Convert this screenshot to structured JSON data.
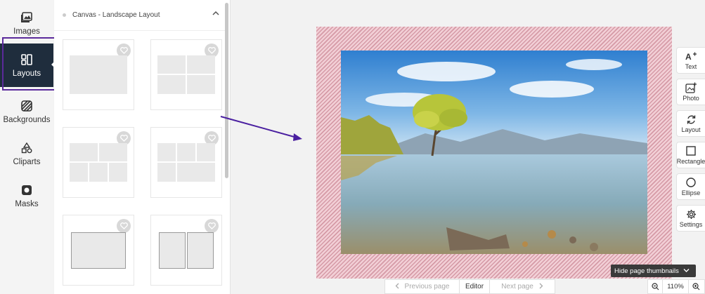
{
  "nav": {
    "items": [
      {
        "label": "Images",
        "icon": "images-icon"
      },
      {
        "label": "Layouts",
        "icon": "layouts-icon",
        "active": true
      },
      {
        "label": "Backgrounds",
        "icon": "backgrounds-icon"
      },
      {
        "label": "Cliparts",
        "icon": "cliparts-icon"
      },
      {
        "label": "Masks",
        "icon": "masks-icon"
      }
    ]
  },
  "panel": {
    "section_title": "Canvas - Landscape Layout"
  },
  "toolbar": {
    "items": [
      {
        "label": "Text",
        "icon": "text-add-icon"
      },
      {
        "label": "Photo",
        "icon": "photo-add-icon"
      },
      {
        "label": "Layout",
        "icon": "layout-refresh-icon"
      },
      {
        "label": "Rectangle",
        "icon": "rectangle-icon"
      },
      {
        "label": "Ellipse",
        "icon": "ellipse-icon"
      },
      {
        "label": "Settings",
        "icon": "gear-icon"
      }
    ]
  },
  "bottom": {
    "previous_page": "Previous page",
    "editor": "Editor",
    "next_page": "Next page",
    "hide_thumbnails": "Hide page thumbnails",
    "zoom_level": "110%"
  },
  "colors": {
    "nav_active": "#1f2d3d",
    "annotation": "#5b2a9b",
    "safe_zone": "#d59aa6"
  }
}
